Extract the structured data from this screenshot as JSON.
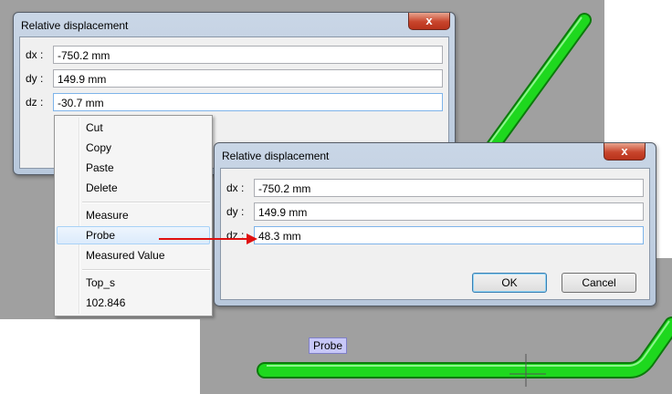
{
  "back_dialog": {
    "title": "Relative displacement",
    "close_label": "x",
    "dx_label": "dx :",
    "dx_value": "-750.2 mm",
    "dy_label": "dy :",
    "dy_value": "149.9 mm",
    "dz_label": "dz :",
    "dz_value": "-30.7 mm"
  },
  "context_menu": {
    "items": [
      "Cut",
      "Copy",
      "Paste",
      "Delete",
      "Measure",
      "Probe",
      "Measured Value",
      "Top_s",
      "102.846"
    ],
    "highlighted": "Probe"
  },
  "front_dialog": {
    "title": "Relative displacement",
    "close_label": "x",
    "dx_label": "dx :",
    "dx_value": "-750.2 mm",
    "dy_label": "dy :",
    "dy_value": "149.9 mm",
    "dz_label": "dz :",
    "dz_value": "48.3 mm",
    "ok_label": "OK",
    "cancel_label": "Cancel"
  },
  "viewport": {
    "probe_tag": "Probe",
    "pipe_color": "#1ed81e",
    "background_color": "#a0a0a0"
  },
  "arrow_color": "#e01010"
}
